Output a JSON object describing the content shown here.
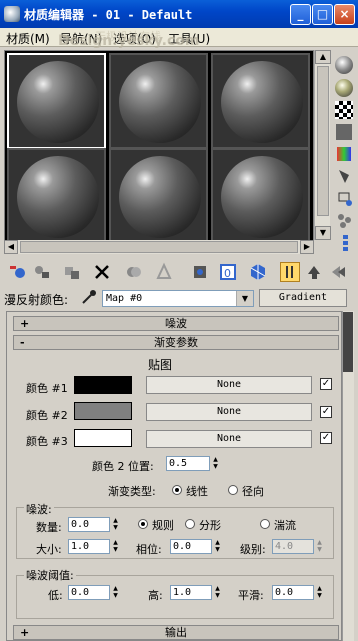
{
  "window": {
    "title": "材质编辑器 - 01 - Default",
    "minimize": "_",
    "maximize": "□",
    "close": "×"
  },
  "menu": [
    "材质(M)",
    "导航(N)",
    "选项(O)",
    "工具(U)"
  ],
  "watermark": {
    "main": "Design.yesky.com",
    "sub": "天极设计在线"
  },
  "map_row": {
    "label": "漫反射颜色:",
    "map_name": "Map #0",
    "map_type": "Gradient"
  },
  "rollouts": {
    "noise": {
      "sign": "+",
      "title": "噪波"
    },
    "gradient_params": {
      "sign": "-",
      "title": "渐变参数"
    },
    "output": {
      "sign": "+",
      "title": "输出"
    }
  },
  "gradient": {
    "maps_heading": "贴图",
    "colors": [
      {
        "label": "颜色 #1",
        "color": "#000000",
        "map": "None",
        "checked": true
      },
      {
        "label": "颜色 #2",
        "color": "#808080",
        "map": "None",
        "checked": true
      },
      {
        "label": "颜色 #3",
        "color": "#ffffff",
        "map": "None",
        "checked": true
      }
    ],
    "position_label": "颜色 2 位置:",
    "position_value": "0.5",
    "type_label": "渐变类型:",
    "type_options": [
      "线性",
      "径向"
    ],
    "type_selected": "线性"
  },
  "noise_group": {
    "title": "噪波:",
    "amount_label": "数量:",
    "amount": "0.0",
    "size_label": "大小:",
    "size": "1.0",
    "phase_label": "相位:",
    "phase": "0.0",
    "levels_label": "级别:",
    "levels": "4.0",
    "options": [
      "规则",
      "分形",
      "湍流"
    ],
    "selected": "规则"
  },
  "threshold_group": {
    "title": "噪波阈值:",
    "low_label": "低:",
    "low": "0.0",
    "high_label": "高:",
    "high": "1.0",
    "smooth_label": "平滑:",
    "smooth": "0.0"
  }
}
